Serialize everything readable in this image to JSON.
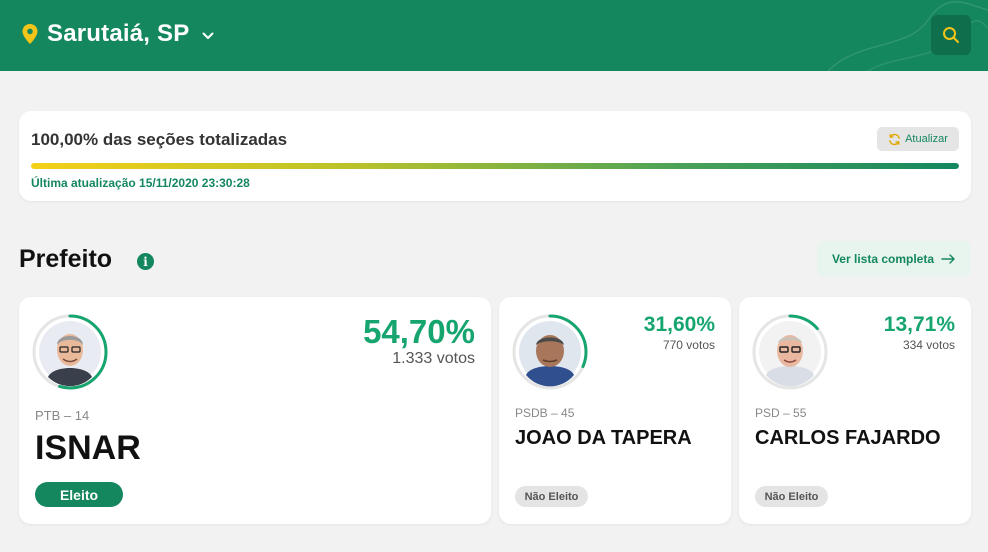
{
  "header": {
    "location": "Sarutaiá, SP",
    "pin_icon": "map-pin-icon",
    "dropdown_icon": "chevron-down-icon",
    "search_icon": "search-icon"
  },
  "progress": {
    "title": "100,00% das seções totalizadas",
    "refresh_label": "Atualizar",
    "percent": 100,
    "last_update": "Última atualização 15/11/2020 23:30:28"
  },
  "section": {
    "title": "Prefeito",
    "info_icon": "info-icon",
    "list_button": "Ver lista completa",
    "list_icon": "arrow-right-icon"
  },
  "candidates": [
    {
      "party": "PTB – 14",
      "name": "ISNAR",
      "percent": "54,70%",
      "votes": "1.333 votos",
      "share": 54.7,
      "status": "Eleito"
    },
    {
      "party": "PSDB – 45",
      "name": "JOAO DA TAPERA",
      "percent": "31,60%",
      "votes": "770 votos",
      "share": 31.6,
      "status": "Não Eleito"
    },
    {
      "party": "PSD – 55",
      "name": "CARLOS FAJARDO",
      "percent": "13,71%",
      "votes": "334 votos",
      "share": 13.71,
      "status": "Não Eleito"
    }
  ],
  "colors": {
    "brand": "#14875f",
    "accent": "#16a46f",
    "pin": "#f4c418"
  }
}
